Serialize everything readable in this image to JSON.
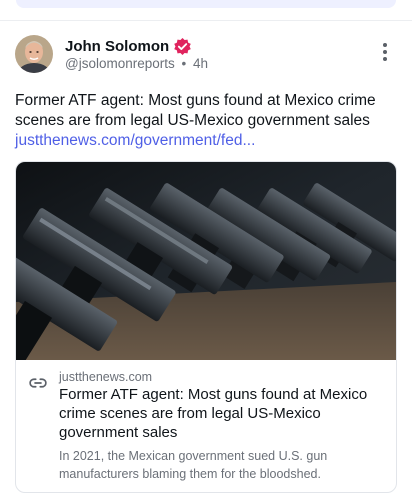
{
  "post": {
    "author_name": "John Solomon",
    "handle": "@jsolomonreports",
    "separator": "•",
    "time": "4h",
    "text": "Former ATF agent: Most guns found at Mexico crime scenes are from legal US-Mexico government sales",
    "link_text": "justthenews.com/government/fed...",
    "icons": {
      "verified": "verified-badge-icon",
      "menu": "more-vertical-icon",
      "link": "link-icon"
    },
    "colors": {
      "accent": "#4f5fe6",
      "verified": "#e0245e",
      "muted": "#6b7078"
    }
  },
  "card": {
    "domain": "justthenews.com",
    "title": "Former ATF agent: Most guns found at Mexico crime scenes are from legal US-Mexico government sales",
    "description": "In 2021, the Mexican government sued U.S. gun manufacturers blaming them for the bloodshed."
  }
}
